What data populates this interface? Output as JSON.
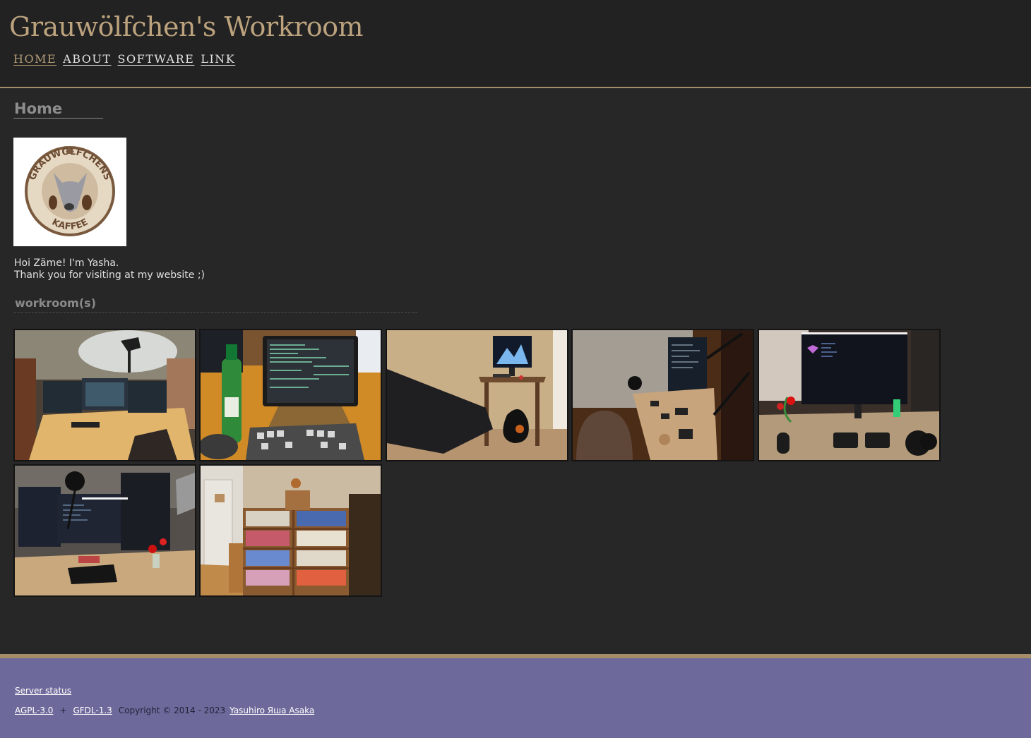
{
  "header": {
    "site_title": "Grauwölfchen's Workroom",
    "nav": [
      {
        "label": "HOME",
        "active": true
      },
      {
        "label": "ABOUT",
        "active": false
      },
      {
        "label": "SOFTWARE",
        "active": false
      },
      {
        "label": "LINK",
        "active": false
      }
    ]
  },
  "main": {
    "page_heading": "Home",
    "logo": {
      "text_top": "GRAUWÖLFCHENS",
      "text_bottom": "KAFFEE"
    },
    "intro_line1": "Hoi Zäme! I'm Yasha.",
    "intro_line2": "Thank you for visiting at my website ;)",
    "section_heading": "workroom(s)",
    "photos": [
      {
        "subject": "desk with three monitors and lamp"
      },
      {
        "subject": "laptop on stand with keyboard and bottle"
      },
      {
        "subject": "desk with monitor and camping chair"
      },
      {
        "subject": "wooden desk with monitor at night"
      },
      {
        "subject": "desk with monitor and split keyboard"
      },
      {
        "subject": "desk with stacked monitors and microphone"
      },
      {
        "subject": "bookshelves in corner of room"
      }
    ]
  },
  "footer": {
    "server_status": "Server status",
    "license1": "AGPL-3.0",
    "plus": "+",
    "license2": "GFDL-1.3",
    "copyright": "Copyright © 2014 - 2023",
    "author": "Yasuhiro Яша Asaka"
  },
  "colors": {
    "accent": "#a58d6a",
    "title": "#bca37e",
    "footer_bg": "#6d6a9b",
    "page_bg": "#272727"
  }
}
